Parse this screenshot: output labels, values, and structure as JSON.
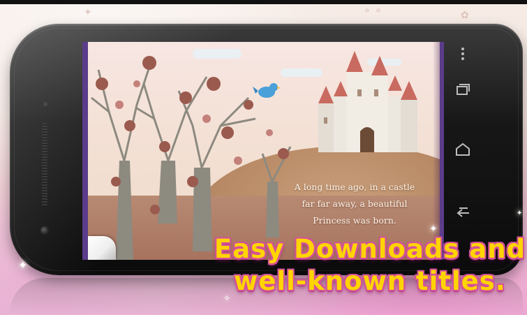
{
  "story": {
    "line1": "A long time ago, in a castle",
    "line2": "far far away, a beautiful",
    "line3": "Princess was born."
  },
  "headline": {
    "line1": "Easy Downloads and",
    "line2": "well-known titles."
  },
  "softkeys": {
    "menu_icon": "more-vertical-icon",
    "recents_icon": "recent-apps-icon",
    "home_icon": "home-icon",
    "back_icon": "back-icon"
  },
  "colors": {
    "headline_fill": "#ffd400",
    "headline_outline": "#d4519a",
    "screen_frame": "#5b3c8a",
    "bird": "#4aa0d8"
  }
}
